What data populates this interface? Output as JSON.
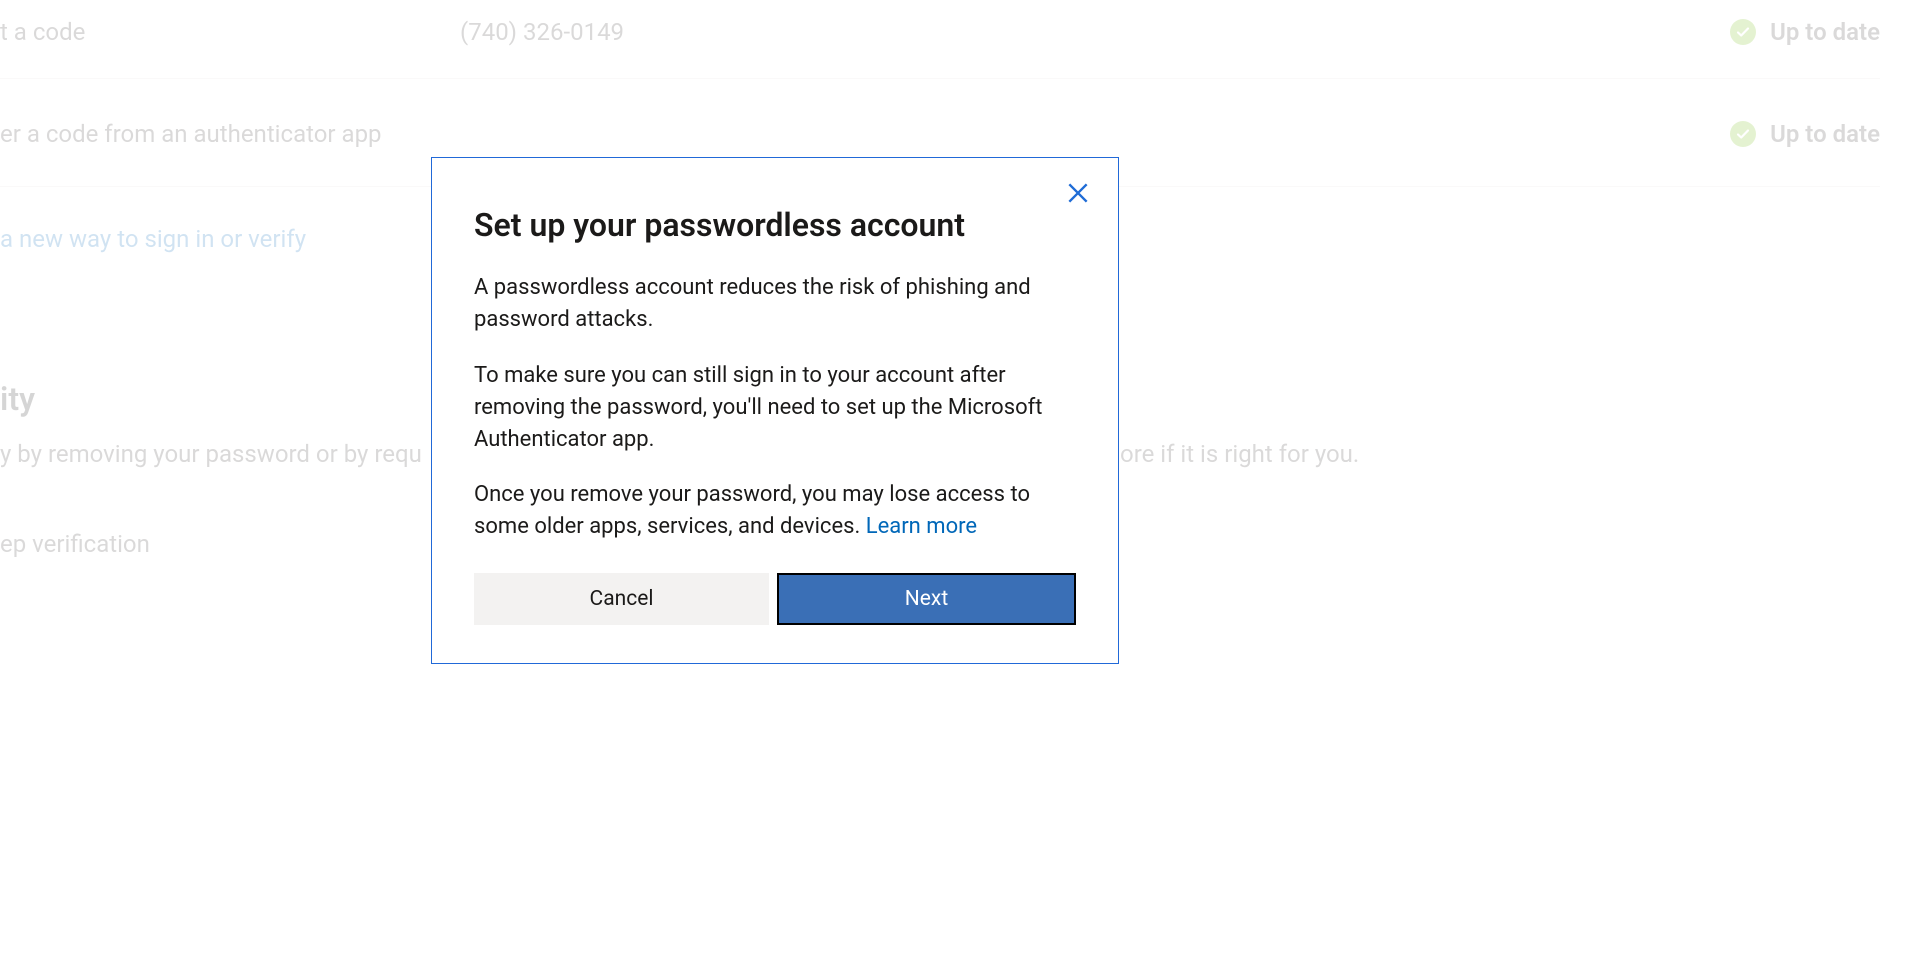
{
  "background": {
    "row1": {
      "method": "t a code",
      "value": "(740) 326-0149",
      "status": "Up to date"
    },
    "row2": {
      "method": "er a code from an authenticator app",
      "status": "Up to date"
    },
    "add_link": "a new way to sign in or verify",
    "security_heading": "ity",
    "security_body_left": "y by removing your password or by requ",
    "security_body_right": "ore if it is right for you.",
    "two_step": "ep verification"
  },
  "modal": {
    "title": "Set up your passwordless account",
    "p1": "A passwordless account reduces the risk of phishing and password attacks.",
    "p2": "To make sure you can still sign in to your account after removing the password, you'll need to set up the Microsoft Authenticator app.",
    "p3_prefix": "Once you remove your password, you may lose access to some older apps, services, and devices. ",
    "learn_more": "Learn more",
    "cancel": "Cancel",
    "next": "Next"
  }
}
